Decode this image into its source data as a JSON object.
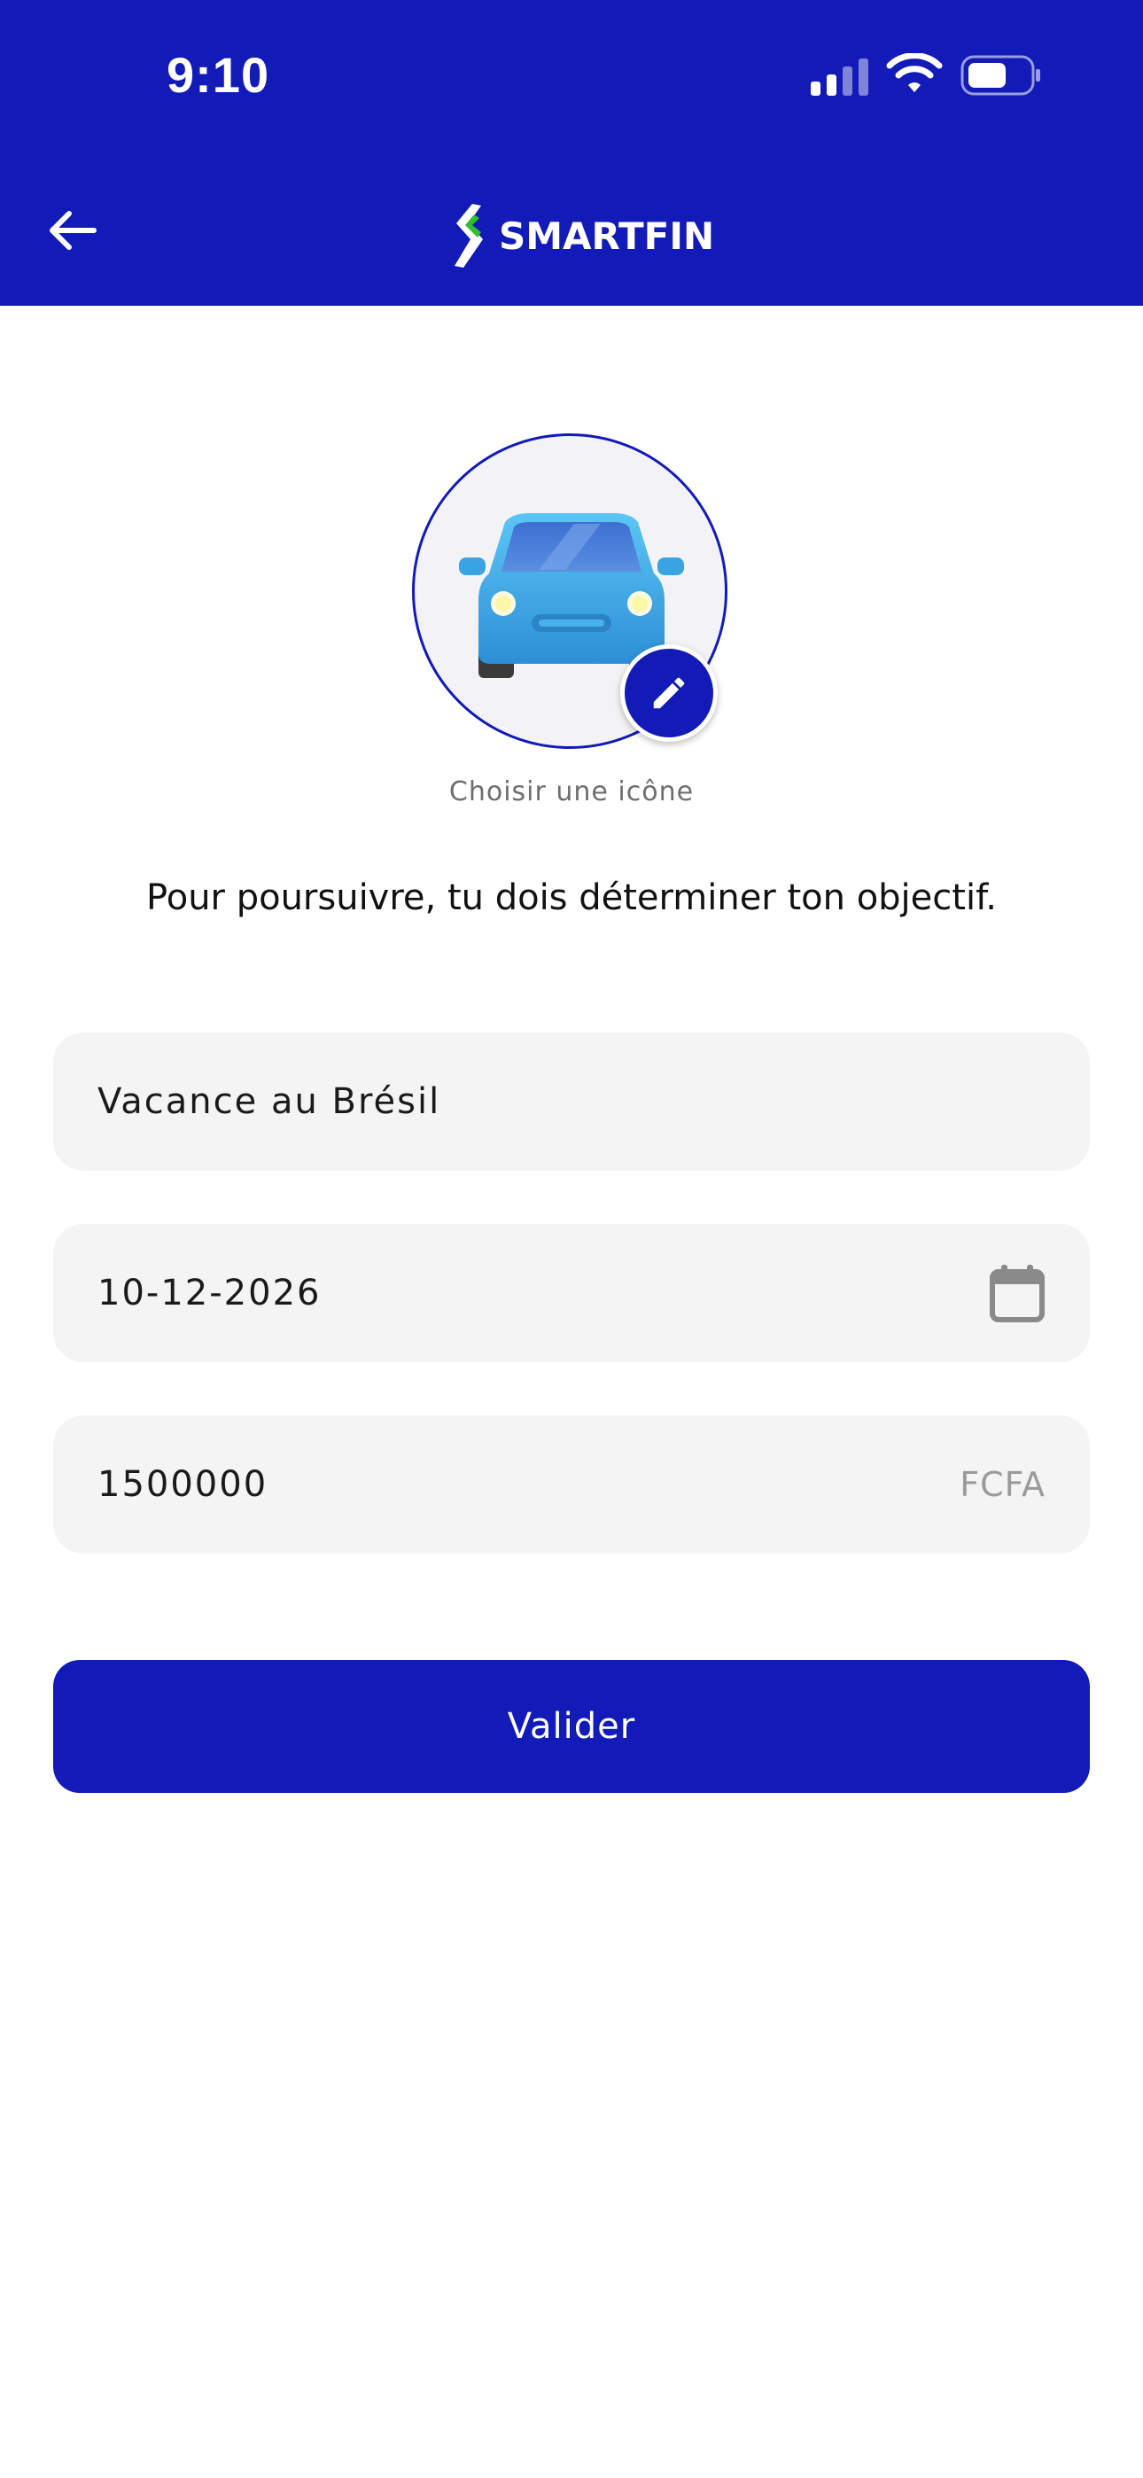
{
  "status_bar": {
    "time": "9:10"
  },
  "header": {
    "brand": "SMARTFIN",
    "background_color": "#121ab7"
  },
  "goal_icon": {
    "icon": "car-icon",
    "label": "Choisir une icône"
  },
  "prompt": "Pour poursuivre, tu dois déterminer ton objectif.",
  "form": {
    "goal_name": "Vacance au Brésil",
    "target_date": "10-12-2026",
    "amount": "1500000",
    "currency": "FCFA",
    "submit_label": "Valider"
  }
}
